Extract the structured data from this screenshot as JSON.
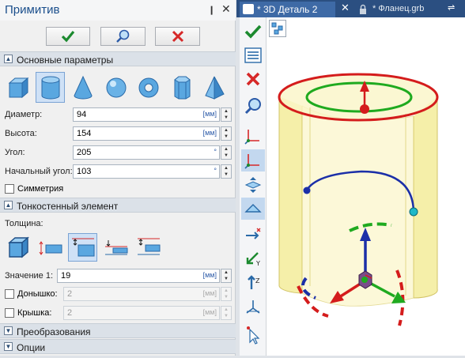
{
  "panel": {
    "title": "Примитив",
    "pin_icon": "pin-icon",
    "close_label": "✕",
    "ok_icon": "check-icon",
    "preview_icon": "preview-magnifier-icon",
    "cancel_icon": "cancel-x-icon"
  },
  "sections": {
    "basic": "Основные параметры",
    "thin": "Тонкостенный элемент",
    "transform": "Преобразования",
    "options": "Опции"
  },
  "shapes": [
    "box-icon",
    "cylinder-icon",
    "cone-icon",
    "sphere-icon",
    "torus-icon",
    "prism-icon",
    "pyramid-icon"
  ],
  "fields": {
    "diameter": {
      "label": "Диаметр:",
      "value": "94",
      "unit": "[мм]"
    },
    "height": {
      "label": "Высота:",
      "value": "154",
      "unit": "[мм]"
    },
    "angle": {
      "label": "Угол:",
      "value": "205",
      "unit": "°"
    },
    "start_angle": {
      "label": "Начальный угол:",
      "value": "103",
      "unit": "°"
    }
  },
  "symmetry_label": "Симметрия",
  "thickness_label": "Толщина:",
  "value1": {
    "label": "Значение 1:",
    "value": "19",
    "unit": "[мм]"
  },
  "bottom": {
    "label": "Донышко:",
    "value": "2",
    "unit": "[мм]"
  },
  "lid": {
    "label": "Крышка:",
    "value": "2",
    "unit": "[мм]"
  },
  "tabs": {
    "active": "* 3D Деталь 2",
    "close": "✕",
    "inactive": "* Фланец.grb"
  },
  "colors": {
    "accent": "#2b4f81",
    "ok": "#1c8a2f",
    "cancel": "#d62828"
  }
}
